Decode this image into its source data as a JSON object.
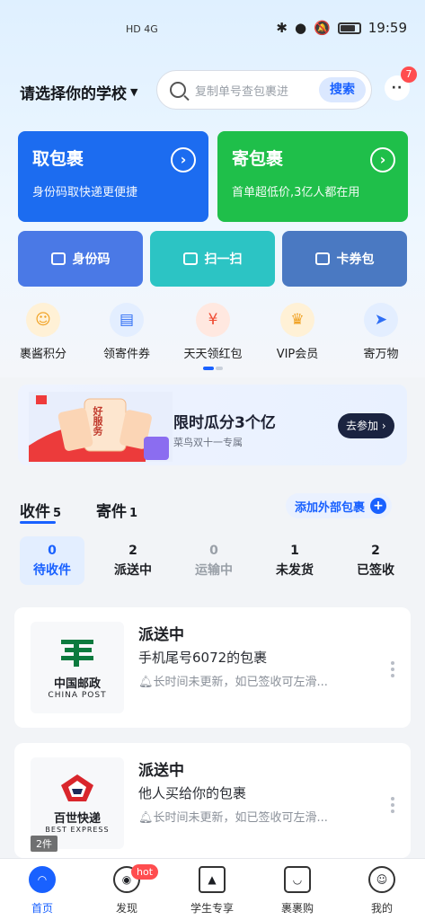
{
  "status_bar": {
    "network": "HD 4G",
    "time": "19:59"
  },
  "header": {
    "school_label": "请选择你的学校",
    "search_placeholder": "复制单号查包裹进",
    "search_button": "搜索",
    "message_badge": "7",
    "message_icon": "chat-bubble-icon"
  },
  "big_cards": [
    {
      "title": "取包裹",
      "subtitle": "身份码取快递更便捷",
      "color": "#1c6cf0"
    },
    {
      "title": "寄包裹",
      "subtitle": "首单超低价,3亿人都在用",
      "color": "#1fbf4a"
    }
  ],
  "quick_buttons": [
    {
      "label": "身份码",
      "icon": "id-code-icon",
      "color": "#4a79e6"
    },
    {
      "label": "扫一扫",
      "icon": "scan-icon",
      "color": "#2cc4c4"
    },
    {
      "label": "卡券包",
      "icon": "wallet-icon",
      "color": "#4a79c2"
    }
  ],
  "icon_row": [
    {
      "label": "裹酱积分",
      "icon": "smile-coin-icon",
      "glyph": "☺",
      "bg": "#fff1d6",
      "fg": "#f0a020"
    },
    {
      "label": "领寄件券",
      "icon": "coupon-icon",
      "glyph": "▤",
      "bg": "#e3eeff",
      "fg": "#2e6ef5"
    },
    {
      "label": "天天领红包",
      "icon": "red-packet-icon",
      "glyph": "¥",
      "bg": "#ffe8e0",
      "fg": "#ef4a32"
    },
    {
      "label": "VIP会员",
      "icon": "vip-icon",
      "glyph": "♛",
      "bg": "#fff1d6",
      "fg": "#f0a020"
    },
    {
      "label": "寄万物",
      "icon": "paper-plane-icon",
      "glyph": "➤",
      "bg": "#e3eeff",
      "fg": "#2e6ef5"
    }
  ],
  "banner": {
    "title": "限时瓜分3个亿",
    "subtitle": "菜鸟双十一专属",
    "button": "去参加",
    "art_text": "好服务"
  },
  "tabs": [
    {
      "label": "收件",
      "count": "5"
    },
    {
      "label": "寄件",
      "count": "1"
    }
  ],
  "add_external": "添加外部包裹",
  "status_filters": [
    {
      "count": "0",
      "label": "待收件",
      "active": true
    },
    {
      "count": "2",
      "label": "派送中",
      "active": false
    },
    {
      "count": "0",
      "label": "运输中",
      "active": false
    },
    {
      "count": "1",
      "label": "未发货",
      "active": false
    },
    {
      "count": "2",
      "label": "已签收",
      "active": false
    }
  ],
  "parcels": [
    {
      "carrier_cn": "中国邮政",
      "carrier_en": "CHINA POST",
      "status": "派送中",
      "desc": "手机尾号6072的包裹",
      "note": "长时间未更新，如已签收可左滑...",
      "count": ""
    },
    {
      "carrier_cn": "百世快递",
      "carrier_en": "BEST EXPRESS",
      "status": "派送中",
      "desc": "他人买给你的包裹",
      "note": "长时间未更新，如已签收可左滑...",
      "count": "2件"
    }
  ],
  "bottom_nav": [
    {
      "label": "首页",
      "icon": "home-icon",
      "active": true
    },
    {
      "label": "发现",
      "icon": "discover-icon",
      "active": false
    },
    {
      "label": "学生专享",
      "icon": "graduation-cap-icon",
      "active": false
    },
    {
      "label": "裹裹购",
      "icon": "shopping-bag-icon",
      "active": false
    },
    {
      "label": "我的",
      "icon": "profile-icon",
      "active": false
    }
  ],
  "hot_badge": "hot"
}
